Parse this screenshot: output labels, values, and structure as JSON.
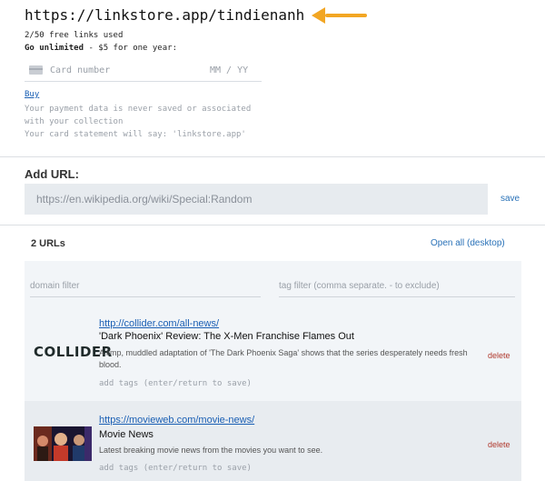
{
  "header": {
    "page_url": "https://linkstore.app/tindienanh",
    "usage": "2/50 free links used",
    "offer_bold": "Go unlimited",
    "offer_rest": " - $5 for one year:",
    "accent_arrow_color": "#f2a623"
  },
  "payment": {
    "card_number_placeholder": "Card number",
    "expiry_placeholder": "MM / YY",
    "buy_label": "Buy",
    "note_privacy": "Your payment data is never saved or associated with your collection",
    "note_statement": "Your card statement will say: 'linkstore.app'"
  },
  "add_url": {
    "label": "Add URL:",
    "placeholder": "https://en.wikipedia.org/wiki/Special:Random",
    "save_label": "save"
  },
  "list": {
    "count_label": "2 URLs",
    "open_all_label": "Open all (desktop)",
    "domain_filter_placeholder": "domain filter",
    "tag_filter_placeholder": "tag filter (comma separate. - to exclude)",
    "items": [
      {
        "url": "http://collider.com/all-news/",
        "title": "'Dark Phoenix' Review: The X-Men Franchise Flames Out",
        "description": "A limp, muddled adaptation of 'The Dark Phoenix Saga' shows that the series desperately needs fresh blood.",
        "thumb_logo": "COLLIDER",
        "tags_placeholder": "add tags (enter/return to save)",
        "delete_label": "delete"
      },
      {
        "url": "https://movieweb.com/movie-news/",
        "title": "Movie News",
        "description": "Latest breaking movie news from the movies you want to see.",
        "thumb_icon": "movie-poster-thumbnail",
        "tags_placeholder": "add tags (enter/return to save)",
        "delete_label": "delete"
      }
    ]
  }
}
